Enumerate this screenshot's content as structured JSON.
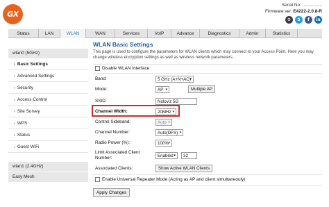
{
  "header": {
    "logo_text": "GX",
    "serial": "Serial No: ................",
    "firmware_label": "Firmware ver.",
    "firmware_version": "E4222-2.0.8-R",
    "social_icons": [
      "settings-icon",
      "skype-icon",
      "facebook-icon",
      "linkedin-icon"
    ],
    "brand_color": "#e8621d"
  },
  "nav": {
    "tabs": [
      {
        "label": "Status"
      },
      {
        "label": "LAN"
      },
      {
        "label": "WLAN"
      },
      {
        "label": "WAN"
      },
      {
        "label": "Services"
      },
      {
        "label": "VoIP"
      },
      {
        "label": "Advance"
      },
      {
        "label": "Diagnostics"
      },
      {
        "label": "Admin"
      },
      {
        "label": "Statistics"
      }
    ],
    "active_tab": "WLAN"
  },
  "sidebar": {
    "section_title": "wlan0 (5GHz)",
    "items": [
      {
        "label": "Basic Settings"
      },
      {
        "label": "Advanced Settings"
      },
      {
        "label": "Security"
      },
      {
        "label": "Access Control"
      },
      {
        "label": "Site Survey"
      },
      {
        "label": "WPS"
      },
      {
        "label": "Status"
      },
      {
        "label": "Guest WiFi"
      }
    ],
    "section2_title": "wlan1 (2.4GHz)",
    "section3_title": "Easy Mesh"
  },
  "main": {
    "title": "WLAN Basic Settings",
    "description": "This page is used to configure the parameters for WLAN clients which may connect to your Access Point. Here you may change wireless encryption settings as well as wireless network parameters.",
    "disable_wlan_label": "Disable WLAN Interface",
    "band_label": "Band:",
    "band_value": "5 GHz (A+N+AC)",
    "mode_label": "Mode:",
    "mode_value": "AP",
    "multiple_ap_label": "Multiple AP",
    "ssid_label": "SSID:",
    "ssid_value": "Noloviz 5G",
    "channel_width_label": "Channel Width:",
    "channel_width_value": "20MHz",
    "control_sideband_label": "Control Sideband:",
    "control_sideband_value": "Auto",
    "channel_number_label": "Channel Number:",
    "channel_number_value": "Auto(DFS)",
    "radio_power_label": "Radio Power (%):",
    "radio_power_value": "100%",
    "limit_clients_label_1": "Limit Associated Client",
    "limit_clients_label_2": "Number:",
    "limit_clients_value": "Enabled",
    "limit_clients_number": "32",
    "associated_clients_label": "Associated Clients:",
    "show_clients_button": "Show Active WLAN Clients",
    "repeater_label": "Enable Universal Repeater Mode (Acting as AP and client simultaneouly)",
    "apply_button": "Apply Changes",
    "highlight_color": "#d12b2b"
  }
}
